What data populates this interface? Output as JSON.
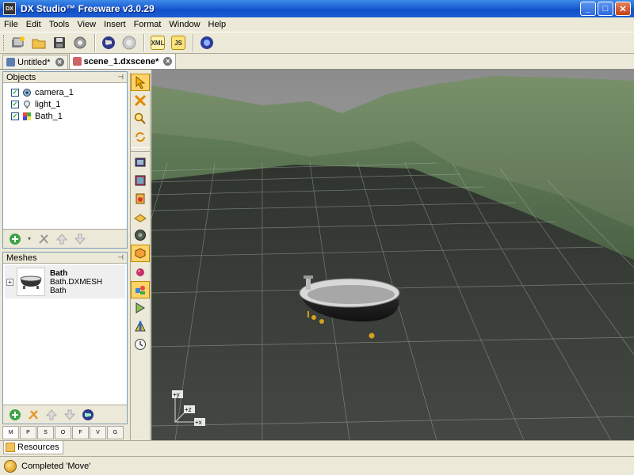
{
  "window": {
    "title": "DX Studio™ Freeware v3.0.29",
    "app_icon_label": "DX"
  },
  "menu": [
    "File",
    "Edit",
    "Tools",
    "View",
    "Insert",
    "Format",
    "Window",
    "Help"
  ],
  "toolbar": {
    "buttons": [
      "new-project-icon",
      "open-folder-icon",
      "save-icon",
      "settings-gear-icon",
      "globe-icon",
      "globe-disabled-icon",
      "xml-icon",
      "javascript-icon",
      "help-icon"
    ],
    "xml_label": "XML",
    "js_label": "JS"
  },
  "doc_tabs": [
    {
      "label": "Untitled*",
      "active": false
    },
    {
      "label": "scene_1.dxscene*",
      "active": true
    }
  ],
  "objects_panel": {
    "title": "Objects",
    "pin": "⊣",
    "items": [
      {
        "label": "camera_1",
        "checked": true,
        "icon": "camera-icon"
      },
      {
        "label": "light_1",
        "checked": true,
        "icon": "light-bulb-icon"
      },
      {
        "label": "Bath_1",
        "checked": true,
        "icon": "mesh-object-icon"
      }
    ]
  },
  "meshes_panel": {
    "title": "Meshes",
    "items": [
      {
        "name": "Bath",
        "file": "Bath.DXMESH",
        "category": "Bath"
      }
    ]
  },
  "bottom_tabs": [
    "M",
    "P",
    "S",
    "O",
    "F",
    "V",
    "G"
  ],
  "resources_tab": "Resources",
  "status": {
    "text": "Completed 'Move'"
  },
  "axes": {
    "y": "+y",
    "z": "+z",
    "x": "+x"
  },
  "colors": {
    "titlebar": "#1d5fd6",
    "active_tool": "#ffd36b",
    "grid": "#9aa59a"
  }
}
